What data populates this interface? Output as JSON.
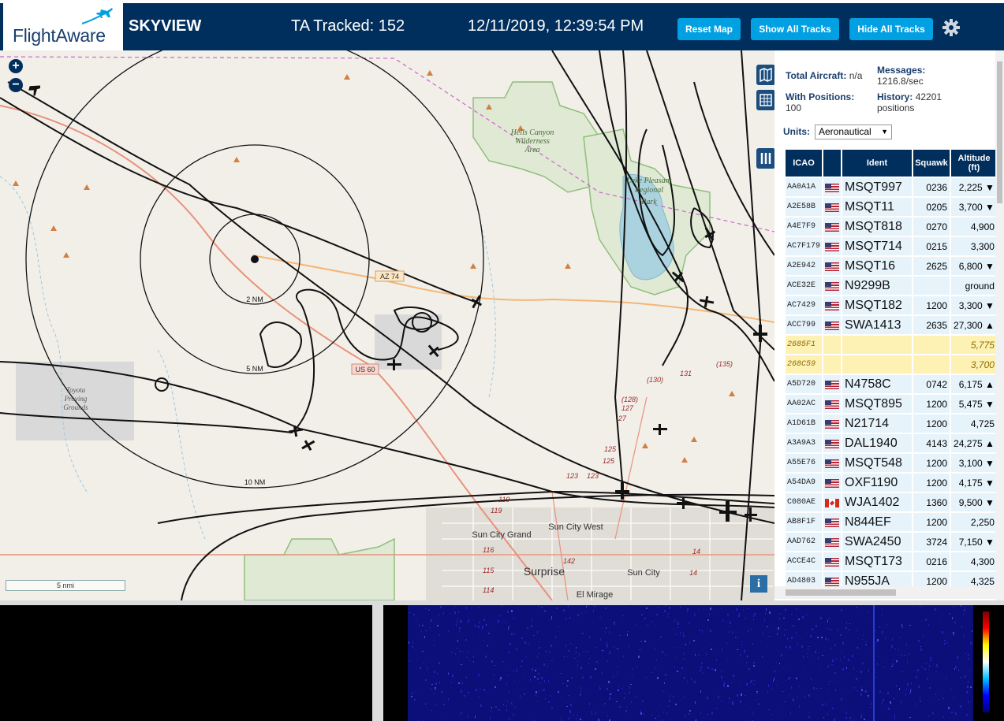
{
  "header": {
    "logo_text": "FlightAware",
    "app_name": "SKYVIEW",
    "tracked": "TA Tracked: 152",
    "datetime": "12/11/2019, 12:39:54 PM",
    "buttons": {
      "reset_map": "Reset Map",
      "show_all_tracks": "Show All Tracks",
      "hide_all_tracks": "Hide All Tracks"
    },
    "colors": {
      "bar": "#002f5d",
      "button": "#00a0e2"
    }
  },
  "map": {
    "zoom_in": "+",
    "zoom_out": "−",
    "range_rings": [
      "2 NM",
      "5 NM",
      "10 NM"
    ],
    "scale_label": "5 nmi",
    "info_button": "i",
    "places": {
      "hells_canyon": [
        "Hells Canyon",
        "Wilderness",
        "Area"
      ],
      "lake_pleasant": [
        "Lake Pleasant",
        "Regional",
        "Park"
      ],
      "toyota": [
        "Toyota",
        "Proving",
        "Grounds"
      ],
      "sun_city_grand": "Sun City Grand",
      "sun_city_west": "Sun City West",
      "surprise": "Surprise",
      "sun_city": "Sun City",
      "el_mirage": "El Mirage"
    },
    "roads": {
      "az74": "AZ 74",
      "us60": "US 60",
      "r130": "(130)",
      "r131": "131",
      "r135": "(135)",
      "r128": "(128)",
      "r127": "127",
      "r27": "27",
      "r125a": "125",
      "r125b": "125",
      "r123a": "123",
      "r123b": "123",
      "r119a": "119",
      "r119b": "119",
      "r116": "116",
      "r115": "115",
      "r114": "114",
      "r142": "142",
      "r14a": "14",
      "r14b": "14"
    }
  },
  "sidebar": {
    "total_aircraft_label": "Total Aircraft:",
    "total_aircraft_value": "n/a",
    "with_positions_label": "With Positions:",
    "with_positions_value": "100",
    "messages_label": "Messages:",
    "messages_value": "1216.8/sec",
    "history_label": "History:",
    "history_value": "42201",
    "history_unit": "positions",
    "units_label": "Units:",
    "units_value": "Aeronautical",
    "columns": {
      "icao": "ICAO",
      "ident": "Ident",
      "squawk": "Squawk",
      "altitude": "Altitude (ft)"
    },
    "rows": [
      {
        "icao": "AA0A1A",
        "flag": "us",
        "ident": "MSQT997",
        "squawk": "0236",
        "altitude": "2,225 ▼"
      },
      {
        "icao": "A2E58B",
        "flag": "us",
        "ident": "MSQT11",
        "squawk": "0205",
        "altitude": "3,700 ▼"
      },
      {
        "icao": "A4E7F9",
        "flag": "us",
        "ident": "MSQT818",
        "squawk": "0270",
        "altitude": "4,900"
      },
      {
        "icao": "AC7F179",
        "flag": "us",
        "ident": "MSQT714",
        "squawk": "0215",
        "altitude": "3,300"
      },
      {
        "icao": "A2E942",
        "flag": "us",
        "ident": "MSQT16",
        "squawk": "2625",
        "altitude": "6,800 ▼"
      },
      {
        "icao": "ACE32E",
        "flag": "us",
        "ident": "N9299B",
        "squawk": "",
        "altitude": "ground"
      },
      {
        "icao": "AC7429",
        "flag": "us",
        "ident": "MSQT182",
        "squawk": "1200",
        "altitude": "3,300 ▼"
      },
      {
        "icao": "ACC799",
        "flag": "us",
        "ident": "SWA1413",
        "squawk": "2635",
        "altitude": "27,300 ▲"
      },
      {
        "icao": "2685F1",
        "flag": "",
        "ident": "",
        "squawk": "",
        "altitude": "5,775"
      },
      {
        "icao": "268C59",
        "flag": "",
        "ident": "",
        "squawk": "",
        "altitude": "3,700"
      },
      {
        "icao": "A5D720",
        "flag": "us",
        "ident": "N4758C",
        "squawk": "0742",
        "altitude": "6,175 ▲"
      },
      {
        "icao": "AA02AC",
        "flag": "us",
        "ident": "MSQT895",
        "squawk": "1200",
        "altitude": "5,475 ▼"
      },
      {
        "icao": "A1D61B",
        "flag": "us",
        "ident": "N21714",
        "squawk": "1200",
        "altitude": "4,725"
      },
      {
        "icao": "A3A9A3",
        "flag": "us",
        "ident": "DAL1940",
        "squawk": "4143",
        "altitude": "24,275 ▲"
      },
      {
        "icao": "A55E76",
        "flag": "us",
        "ident": "MSQT548",
        "squawk": "1200",
        "altitude": "3,100 ▼"
      },
      {
        "icao": "A54DA9",
        "flag": "us",
        "ident": "OXF1190",
        "squawk": "1200",
        "altitude": "4,175 ▼"
      },
      {
        "icao": "C080AE",
        "flag": "ca",
        "ident": "WJA1402",
        "squawk": "1360",
        "altitude": "9,500 ▼"
      },
      {
        "icao": "AB8F1F",
        "flag": "us",
        "ident": "N844EF",
        "squawk": "1200",
        "altitude": "2,250"
      },
      {
        "icao": "AAD762",
        "flag": "us",
        "ident": "SWA2450",
        "squawk": "3724",
        "altitude": "7,150 ▼"
      },
      {
        "icao": "ACCE4C",
        "flag": "us",
        "ident": "MSQT173",
        "squawk": "0216",
        "altitude": "4,300"
      },
      {
        "icao": "AD4803",
        "flag": "us",
        "ident": "N955JA",
        "squawk": "1200",
        "altitude": "4,325"
      }
    ],
    "colors": {
      "header": "#002f5d",
      "row": "#e6f3fb",
      "no_position_row": "#fef1b4"
    }
  }
}
